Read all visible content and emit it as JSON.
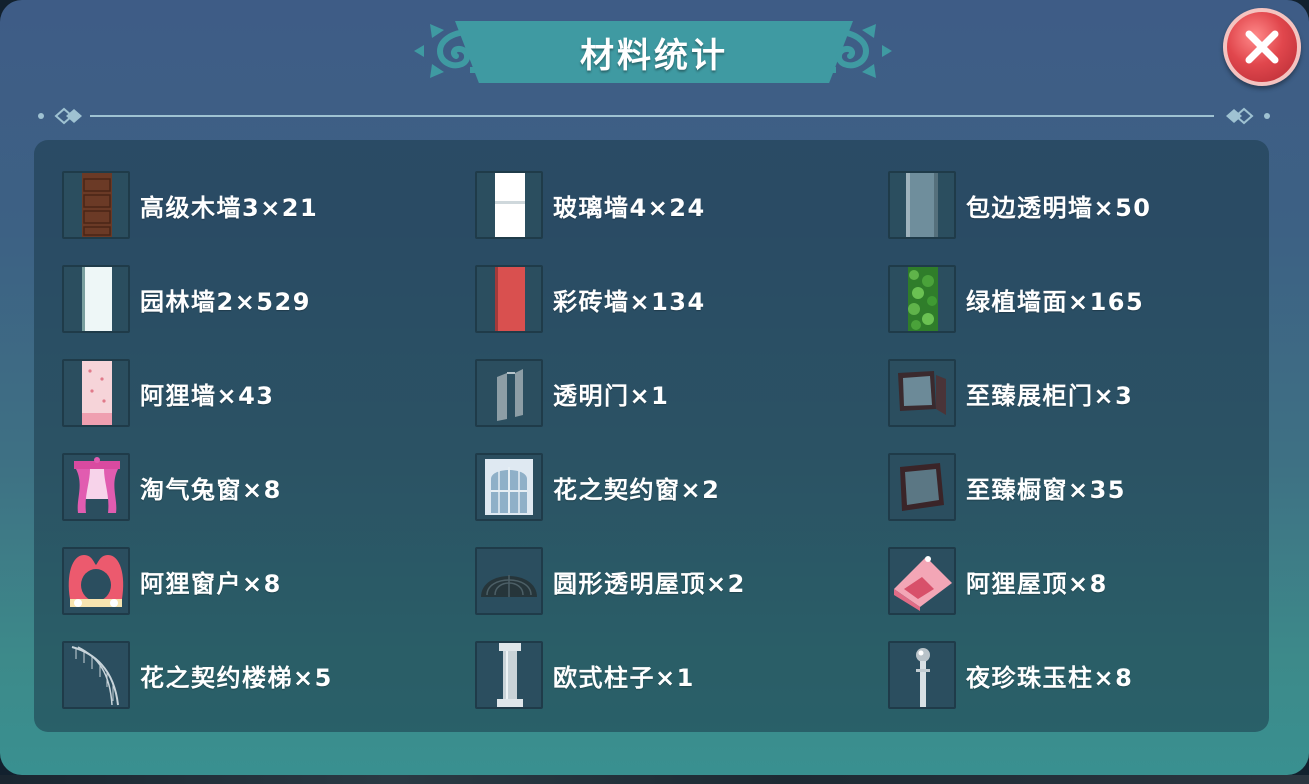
{
  "dialog": {
    "title": "材料统计"
  },
  "items": [
    {
      "label": "高级木墙3×21",
      "icon": "wood-wall-icon"
    },
    {
      "label": "玻璃墙4×24",
      "icon": "glass-wall-icon"
    },
    {
      "label": "包边透明墙×50",
      "icon": "trimmed-transparent-wall-icon"
    },
    {
      "label": "园林墙2×529",
      "icon": "garden-wall-icon"
    },
    {
      "label": "彩砖墙×134",
      "icon": "colored-brick-wall-icon"
    },
    {
      "label": "绿植墙面×165",
      "icon": "green-plant-wall-icon"
    },
    {
      "label": "阿狸墙×43",
      "icon": "ali-wall-icon"
    },
    {
      "label": "透明门×1",
      "icon": "transparent-door-icon"
    },
    {
      "label": "至臻展柜门×3",
      "icon": "display-cabinet-door-icon"
    },
    {
      "label": "淘气兔窗×8",
      "icon": "naughty-rabbit-window-icon"
    },
    {
      "label": "花之契约窗×2",
      "icon": "flower-contract-window-icon"
    },
    {
      "label": "至臻橱窗×35",
      "icon": "showcase-window-icon"
    },
    {
      "label": "阿狸窗户×8",
      "icon": "ali-window-icon"
    },
    {
      "label": "圆形透明屋顶×2",
      "icon": "round-transparent-roof-icon"
    },
    {
      "label": "阿狸屋顶×8",
      "icon": "ali-roof-icon"
    },
    {
      "label": "花之契约楼梯×5",
      "icon": "flower-contract-stairs-icon"
    },
    {
      "label": "欧式柱子×1",
      "icon": "european-pillar-icon"
    },
    {
      "label": "夜珍珠玉柱×8",
      "icon": "night-pearl-pillar-icon"
    }
  ],
  "colors": {
    "title_banner": "#3f9aa2",
    "close_button": "#e1474d"
  }
}
